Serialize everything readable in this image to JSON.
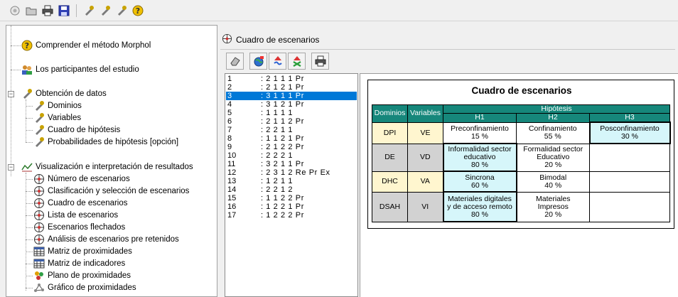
{
  "toolbar": {
    "icons": [
      "wand-icon",
      "folder-icon",
      "print-icon",
      "save-icon",
      "stamp-icon",
      "stamp-icon",
      "stamp-icon",
      "help-icon"
    ]
  },
  "tree": {
    "items": [
      {
        "label": "Comprender el método Morphol",
        "icon": "help-icon"
      },
      {
        "label": "Los participantes del estudio",
        "icon": "users-icon"
      },
      {
        "label": "Obtención de datos",
        "icon": "stamp-icon"
      },
      {
        "label": "Dominios",
        "icon": "stamp-icon"
      },
      {
        "label": "Variables",
        "icon": "stamp-icon"
      },
      {
        "label": "Cuadro de hipótesis",
        "icon": "stamp-icon"
      },
      {
        "label": "Probabilidades de hipótesis [opción]",
        "icon": "stamp-icon"
      },
      {
        "label": "Visualización e interpretación de resultados",
        "icon": "chart-icon"
      },
      {
        "label": "Número de escenarios",
        "icon": "target-icon"
      },
      {
        "label": "Clasificación y selección de escenarios",
        "icon": "target-icon"
      },
      {
        "label": "Cuadro de escenarios",
        "icon": "target-icon"
      },
      {
        "label": "Lista de escenarios",
        "icon": "target-icon"
      },
      {
        "label": "Escenarios flechados",
        "icon": "target-icon"
      },
      {
        "label": "Análisis de escenarios pre retenidos",
        "icon": "target-icon"
      },
      {
        "label": "Matriz de proximidades",
        "icon": "grid-icon"
      },
      {
        "label": "Matriz de indicadores",
        "icon": "grid-icon"
      },
      {
        "label": "Plano de proximidades",
        "icon": "plane-icon"
      },
      {
        "label": "Gráfico de proximidades",
        "icon": "graph-icon"
      }
    ]
  },
  "window": {
    "title": "Cuadro de escenarios"
  },
  "scenarios": {
    "selected_index": 2,
    "rows": [
      {
        "num": "1",
        "code": ": 2 1 1 1 Pr"
      },
      {
        "num": "2",
        "code": ": 2 1 2 1 Pr"
      },
      {
        "num": "3",
        "code": ": 3 1 1 1 Pr"
      },
      {
        "num": "4",
        "code": ": 3 1 2 1 Pr"
      },
      {
        "num": "5",
        "code": ": 1 1 1 1"
      },
      {
        "num": "6",
        "code": ": 2 1 1 2 Pr"
      },
      {
        "num": "7",
        "code": ": 2 2 1 1"
      },
      {
        "num": "8",
        "code": ": 1 1 2 1 Pr"
      },
      {
        "num": "9",
        "code": ": 2 1 2 2 Pr"
      },
      {
        "num": "10",
        "code": ": 2 2 2 1"
      },
      {
        "num": "11",
        "code": ": 3 2 1 1 Pr"
      },
      {
        "num": "12",
        "code": ": 2 3 1 2 Re Pr Ex"
      },
      {
        "num": "13",
        "code": ": 1 2 1 1"
      },
      {
        "num": "14",
        "code": ": 2 2 1 2"
      },
      {
        "num": "15",
        "code": ": 1 1 2 2 Pr"
      },
      {
        "num": "16",
        "code": ": 1 2 2 1 Pr"
      },
      {
        "num": "17",
        "code": ": 1 2 2 2 Pr"
      }
    ]
  },
  "sheet": {
    "title": "Cuadro de escenarios",
    "headers": {
      "dominios": "Dominios",
      "variables": "Variables",
      "hipotesis": "Hipótesis",
      "h1": "H1",
      "h2": "H2",
      "h3": "H3"
    },
    "rows": [
      {
        "dom": "DPI",
        "var": "VE",
        "h1": [
          "Preconfinamiento",
          "15 %"
        ],
        "h2": [
          "Confinamiento",
          "55 %"
        ],
        "h3": [
          "Posconfinamiento",
          "30 %"
        ]
      },
      {
        "dom": "DE",
        "var": "VD",
        "h1": [
          "Informalidad sector",
          "educativo",
          "80 %"
        ],
        "h2": [
          "Formalidad sector",
          "Educativo",
          "20 %"
        ],
        "h3": []
      },
      {
        "dom": "DHC",
        "var": "VA",
        "h1": [
          "Sincrona",
          "60 %"
        ],
        "h2": [
          "Bimodal",
          "40 %"
        ],
        "h3": []
      },
      {
        "dom": "DSAH",
        "var": "VI",
        "h1": [
          "Materiales digitales",
          "y de acceso remoto",
          "80 %"
        ],
        "h2": [
          "Materiales",
          "Impresos",
          "20 %"
        ],
        "h3": []
      }
    ]
  },
  "colors": {
    "header_teal": "#16877b",
    "domain_yellow": "#fff6cf",
    "domain_gray": "#d2d2d2",
    "selected_cell": "#d6f6fa",
    "list_selection": "#0078d7"
  }
}
